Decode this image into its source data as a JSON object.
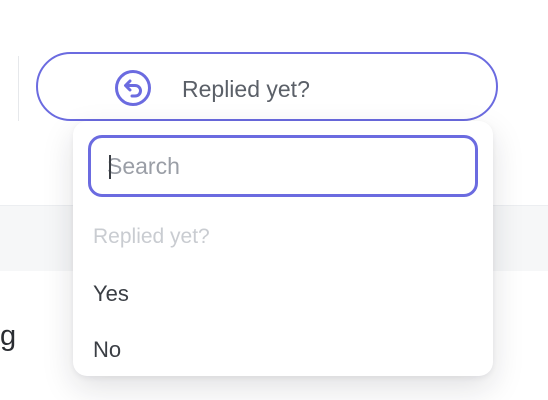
{
  "filter": {
    "label": "Replied yet?",
    "icon": "reply-circle-icon",
    "accent_color": "#6b6be0"
  },
  "dropdown": {
    "search": {
      "value": "",
      "placeholder": "Search"
    },
    "group_label": "Replied yet?",
    "options": [
      {
        "label": "Yes"
      },
      {
        "label": "No"
      }
    ]
  },
  "background": {
    "partial_text": "g"
  }
}
